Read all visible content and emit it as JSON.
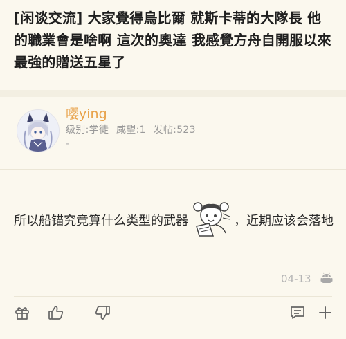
{
  "thread": {
    "title": "[闲谈交流] 大家覺得烏比爾 就斯卡蒂的大隊長 他的職業會是啥啊 這次的奧達 我感覺方舟自開服以來 最強的贈送五星了"
  },
  "post": {
    "author": {
      "name": "嘤ying",
      "level_label": "级别:学徒",
      "prestige_label": "威望:1",
      "posts_label": "发帖:523",
      "extra": "-"
    },
    "content_before": "所以船锚究竟算什么类型的武器",
    "content_after": "，近期应该会落地",
    "time": "04-13",
    "client_icon": "android-icon"
  },
  "toolbar": {
    "icons": [
      "gift-icon",
      "thumbs-up-icon",
      "thumbs-down-icon",
      "comment-icon",
      "plus-icon"
    ]
  },
  "colors": {
    "background": "#fbf8ee",
    "username": "#e8a24a",
    "meta_text": "#9a9a9a",
    "android": "#a8a8a8"
  }
}
